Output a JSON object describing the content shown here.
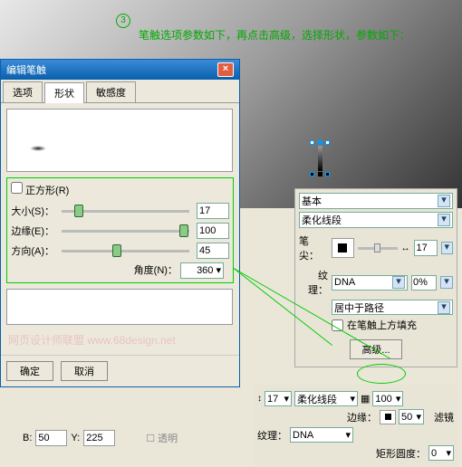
{
  "step": {
    "num": "3",
    "text": "笔触选项参数如下，再点击高级，选择形状，参数如下："
  },
  "dialog": {
    "title": "编辑笔触",
    "tabs": [
      "选项",
      "形状",
      "敏感度"
    ],
    "active_tab": 1,
    "square_chk": "正方形(R)",
    "params": {
      "size": {
        "label": "大小(S)：",
        "value": "17",
        "thumb": 10
      },
      "edge": {
        "label": "边缘(E)：",
        "value": "100",
        "thumb": 92
      },
      "aspect": {
        "label": "方向(A)：",
        "value": "45",
        "thumb": 40
      }
    },
    "angle": {
      "label": "角度(N)：",
      "value": "360"
    },
    "watermark": "网页设计师联盟  www.68design.net",
    "ok": "确定",
    "cancel": "取消"
  },
  "coords": {
    "b_label": "B:",
    "b": "50",
    "y_label": "Y:",
    "y": "225",
    "transparent": "透明"
  },
  "right": {
    "basic": "基本",
    "soft_line": "柔化线段",
    "tip_label": "笔尖：",
    "tip_size": "17",
    "texture_label": "纹理：",
    "texture": "DNA",
    "texture_pct": "0%",
    "center_label": "居中于路径",
    "fill_above": "在笔触上方填充",
    "advanced": "高级..."
  },
  "bottom": {
    "size": "17",
    "type": "柔化线段",
    "opacity": "100",
    "edge_label": "边缘：",
    "edge": "50",
    "filter_label": "滤镜",
    "texture_label": "纹理：",
    "texture": "DNA",
    "rect_round_label": "矩形圆度：",
    "rect_round": "0"
  }
}
